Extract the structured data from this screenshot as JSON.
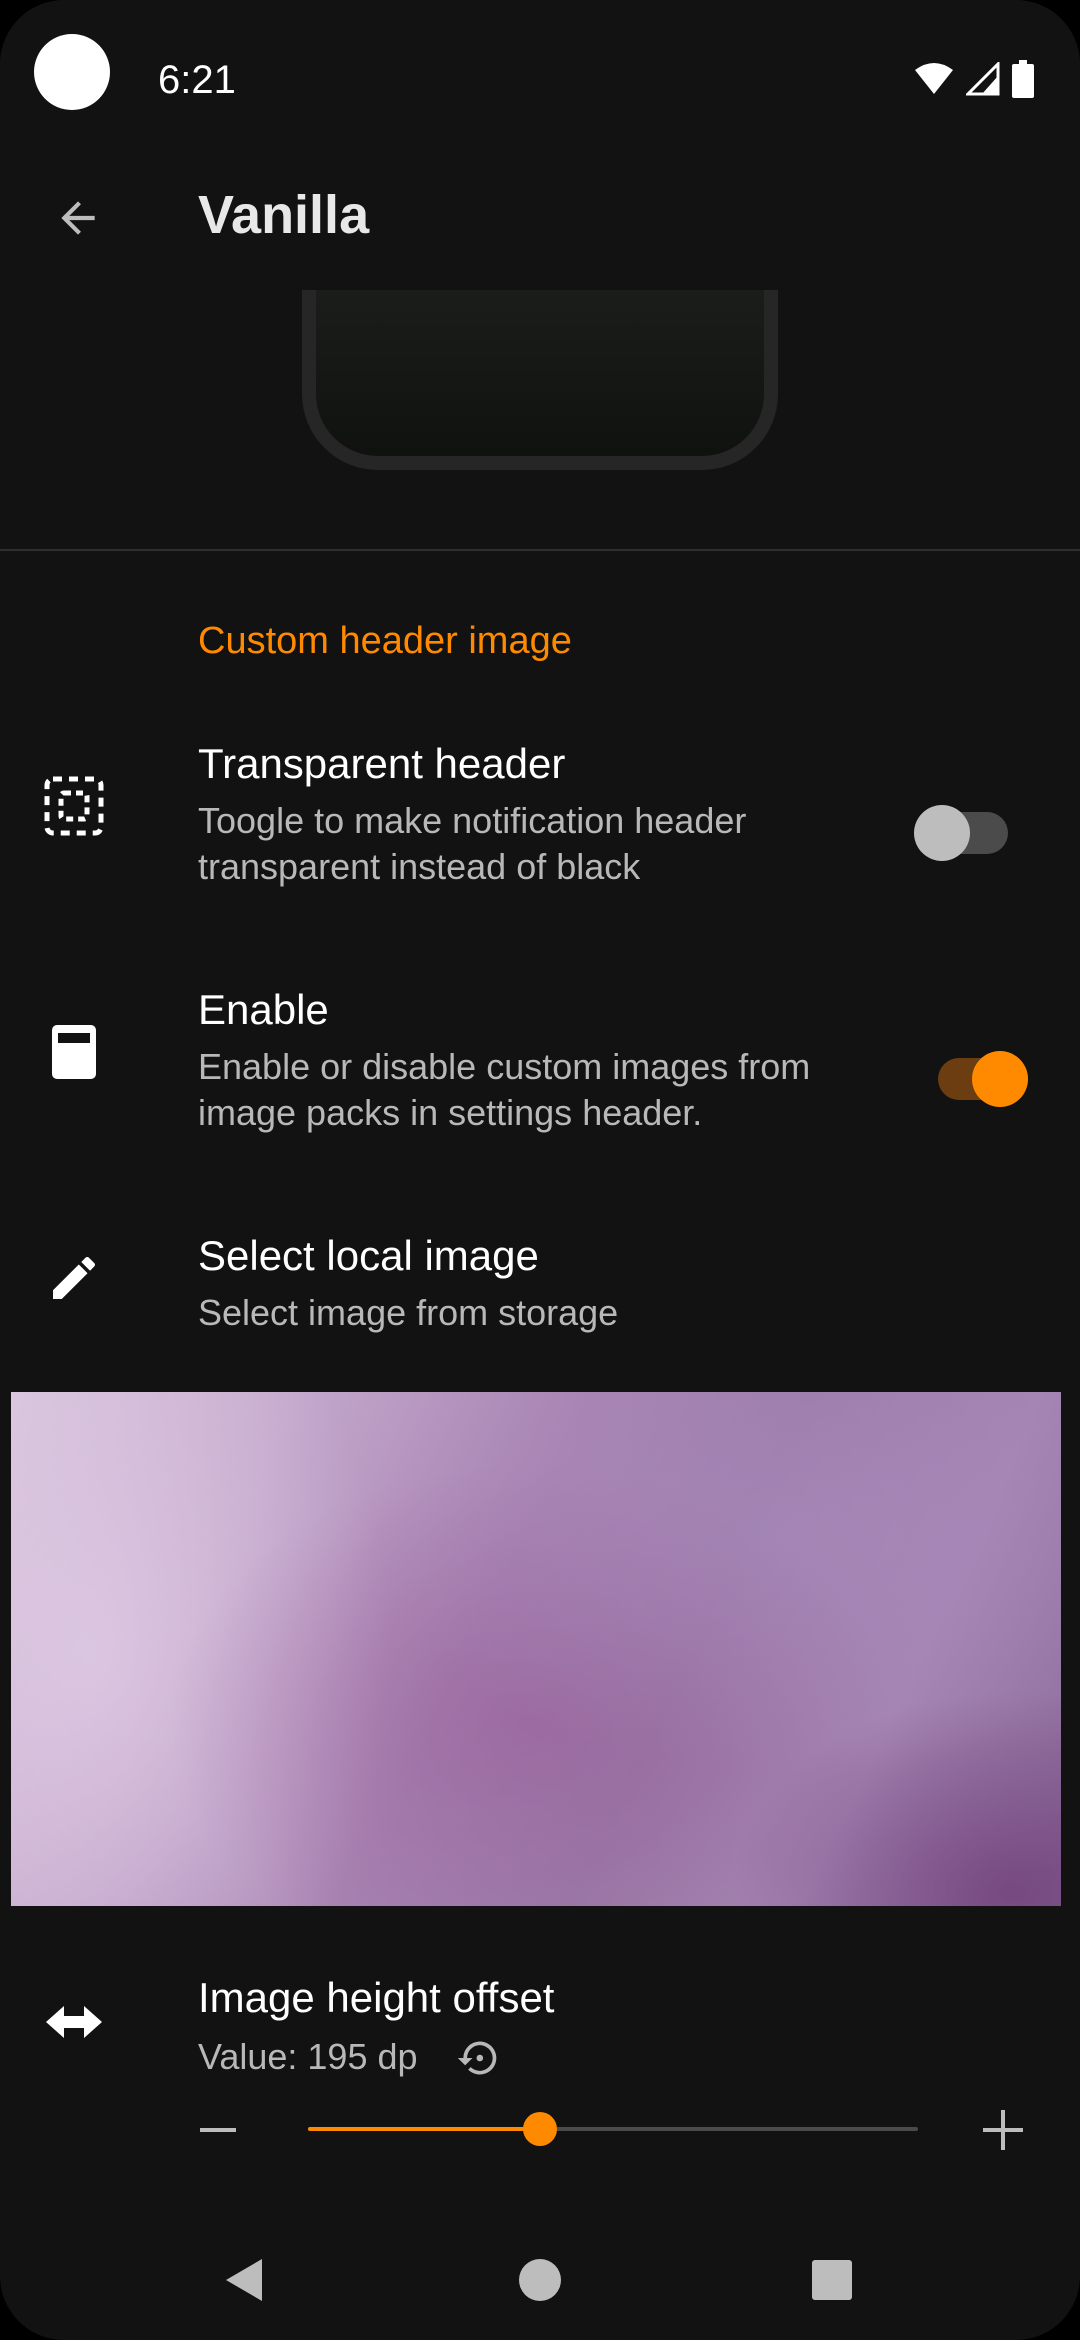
{
  "status_bar": {
    "time": "6:21",
    "icons": [
      "wifi-icon",
      "cellular-signal-icon",
      "battery-icon"
    ]
  },
  "app_bar": {
    "title": "Vanilla",
    "back_icon": "arrow-back-icon"
  },
  "section": {
    "title": "Custom header image"
  },
  "preferences": {
    "transparent_header": {
      "title": "Transparent header",
      "summary": "Toogle to make notification header transparent instead of black",
      "icon": "dashed-select-icon",
      "checked": false
    },
    "enable": {
      "title": "Enable",
      "summary": "Enable or disable custom images from image packs in settings header.",
      "icon": "image-card-icon",
      "checked": true
    },
    "select_local_image": {
      "title": "Select local image",
      "summary": "Select image from storage",
      "icon": "pencil-icon"
    },
    "image_height_offset": {
      "title": "Image height offset",
      "value_text": "Value: 195 dp",
      "icon": "horizontal-arrows-icon",
      "reset_icon": "restore-icon",
      "slider_fraction": 0.38
    }
  },
  "colors": {
    "accent": "#ff8a00",
    "background": "#121212",
    "summary_text": "#b8b8b8"
  },
  "nav_bar": {
    "icons": [
      "back-triangle-icon",
      "home-circle-icon",
      "recents-square-icon"
    ]
  }
}
